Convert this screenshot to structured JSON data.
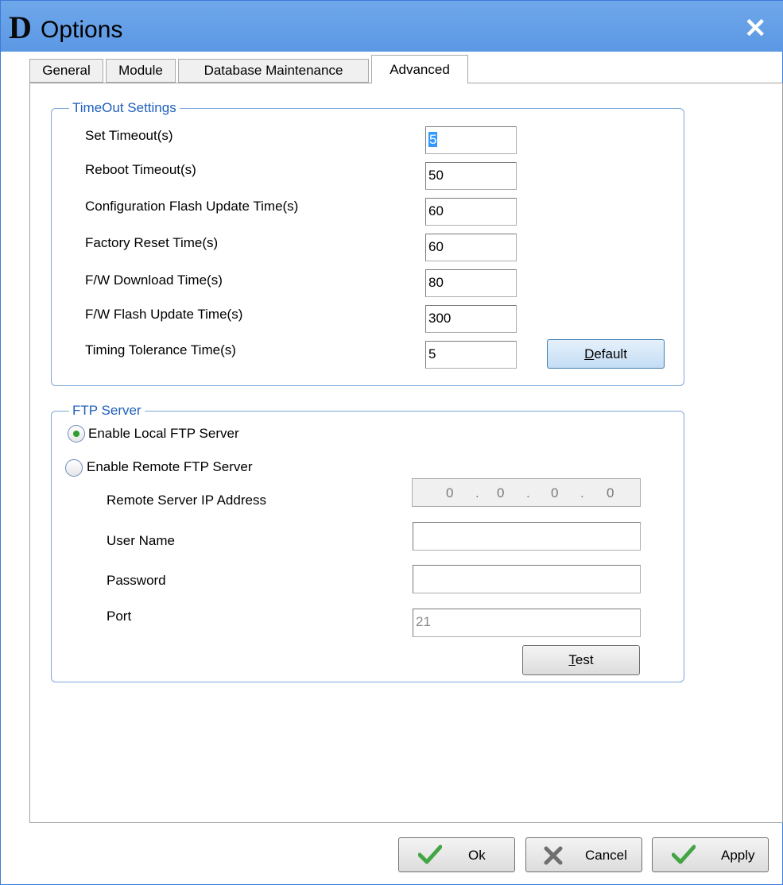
{
  "window": {
    "logo_letter": "D",
    "title": "Options",
    "close_glyph": "✕"
  },
  "tabs": [
    {
      "label": "General",
      "active": false
    },
    {
      "label": "Module",
      "active": false
    },
    {
      "label": "Database Maintenance",
      "active": false
    },
    {
      "label": "Advanced",
      "active": true
    }
  ],
  "timeout": {
    "legend": "TimeOut Settings",
    "fields": [
      {
        "label": "Set Timeout(s)",
        "value": "5"
      },
      {
        "label": "Reboot Timeout(s)",
        "value": "50"
      },
      {
        "label": "Configuration Flash Update Time(s)",
        "value": "60"
      },
      {
        "label": "Factory Reset Time(s)",
        "value": "60"
      },
      {
        "label": "F/W Download  Time(s)",
        "value": "80"
      },
      {
        "label": "F/W Flash Update Time(s)",
        "value": "300"
      },
      {
        "label": "Timing Tolerance Time(s)",
        "value": "5"
      }
    ],
    "default_button": {
      "mnemonic": "D",
      "rest": "efault"
    }
  },
  "ftp": {
    "legend": "FTP Server",
    "local_label": "Enable Local FTP Server",
    "local_selected": true,
    "remote_label": "Enable Remote FTP Server",
    "remote_selected": false,
    "ip_label": "Remote Server IP Address",
    "ip_octets": [
      "0",
      "0",
      "0",
      "0"
    ],
    "ip_separator": ".",
    "user_label": "User Name",
    "user_value": "",
    "password_label": "Password",
    "password_value": "",
    "port_label": "Port",
    "port_value": "21",
    "test_button": {
      "mnemonic": "T",
      "rest": "est"
    }
  },
  "footer": {
    "ok_label": "Ok",
    "cancel_label": "Cancel",
    "apply_label": "Apply"
  },
  "colors": {
    "titlebar": "#5b98e4",
    "legend_text": "#1f5fbd",
    "check_green": "#44a544",
    "cancel_x_gray": "#6f6f6f"
  }
}
